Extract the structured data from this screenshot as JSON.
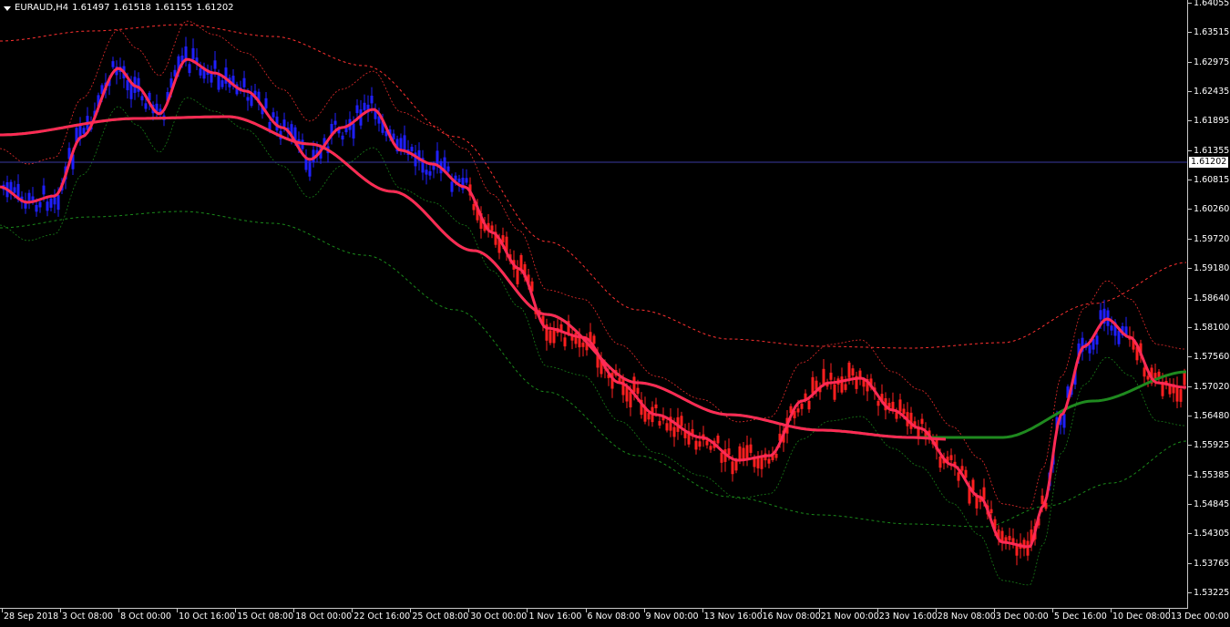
{
  "header": {
    "symbol": "EURAUD,H4",
    "open": "1.61497",
    "high": "1.61518",
    "low": "1.61155",
    "close": "1.61202"
  },
  "current_price": "1.61202",
  "price_axis": [
    "1.64055",
    "1.63515",
    "1.62975",
    "1.62435",
    "1.61895",
    "1.61355",
    "1.60815",
    "1.60260",
    "1.59720",
    "1.59180",
    "1.58640",
    "1.58100",
    "1.57560",
    "1.57020",
    "1.56480",
    "1.55925",
    "1.55385",
    "1.54845",
    "1.54305",
    "1.53765",
    "1.53225"
  ],
  "time_axis": [
    "28 Sep 2018",
    "3 Oct 08:00",
    "8 Oct 00:00",
    "10 Oct 16:00",
    "15 Oct 08:00",
    "18 Oct 00:00",
    "22 Oct 16:00",
    "25 Oct 08:00",
    "30 Oct 00:00",
    "1 Nov 16:00",
    "6 Nov 08:00",
    "9 Nov 00:00",
    "13 Nov 16:00",
    "16 Nov 08:00",
    "21 Nov 00:00",
    "23 Nov 16:00",
    "28 Nov 08:00",
    "3 Dec 00:00",
    "5 Dec 16:00",
    "10 Dec 08:00",
    "13 Dec 00:00"
  ],
  "colors": {
    "background": "#000000",
    "bull_candle": "#1f1fff",
    "bear_candle": "#ff1f1f",
    "fast_ma": "#ff2a55",
    "slow_ma": "#1f8a1f",
    "red_band": "#ff3030",
    "green_band": "#1a8a1a",
    "price_line": "#3a3aa0",
    "axis": "#c8c8c8"
  },
  "chart_data": {
    "type": "candlestick",
    "symbol": "EURAUD",
    "timeframe": "H4",
    "ylim": [
      1.53225,
      1.64055
    ],
    "last_price": 1.61202,
    "key_points": [
      {
        "x": "28 Sep 2018",
        "price": 1.606
      },
      {
        "x": "8 Oct 00:00",
        "price": 1.632
      },
      {
        "x": "10 Oct 16:00",
        "price": 1.633
      },
      {
        "x": "22 Oct 16:00",
        "price": 1.622
      },
      {
        "x": "30 Oct 00:00",
        "price": 1.604
      },
      {
        "x": "1 Nov 16:00",
        "price": 1.581
      },
      {
        "x": "13 Nov 16:00",
        "price": 1.556
      },
      {
        "x": "21 Nov 00:00",
        "price": 1.575
      },
      {
        "x": "3 Dec 00:00",
        "price": 1.536
      },
      {
        "x": "10 Dec 08:00",
        "price": 1.585
      },
      {
        "x": "13 Dec 00:00",
        "price": 1.572
      }
    ],
    "indicators": [
      "fast moving average",
      "slow moving average",
      "upper/lower envelope bands"
    ]
  }
}
